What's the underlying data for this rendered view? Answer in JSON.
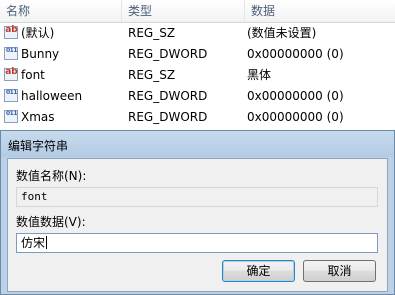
{
  "list": {
    "columns": {
      "name": "名称",
      "type": "类型",
      "data": "数据"
    },
    "rows": [
      {
        "icon": "string-value-icon",
        "name": "(默认)",
        "type": "REG_SZ",
        "data": "(数值未设置)"
      },
      {
        "icon": "dword-value-icon",
        "name": "Bunny",
        "type": "REG_DWORD",
        "data": "0x00000000 (0)"
      },
      {
        "icon": "string-value-icon",
        "name": "font",
        "type": "REG_SZ",
        "data": "黑体"
      },
      {
        "icon": "dword-value-icon",
        "name": "halloween",
        "type": "REG_DWORD",
        "data": "0x00000000 (0)"
      },
      {
        "icon": "dword-value-icon",
        "name": "Xmas",
        "type": "REG_DWORD",
        "data": "0x00000000 (0)"
      }
    ]
  },
  "dialog": {
    "title": "编辑字符串",
    "name_label": "数值名称(N):",
    "name_value": "font",
    "data_label": "数值数据(V):",
    "data_value": "仿宋",
    "ok_label": "确定",
    "cancel_label": "取消"
  }
}
